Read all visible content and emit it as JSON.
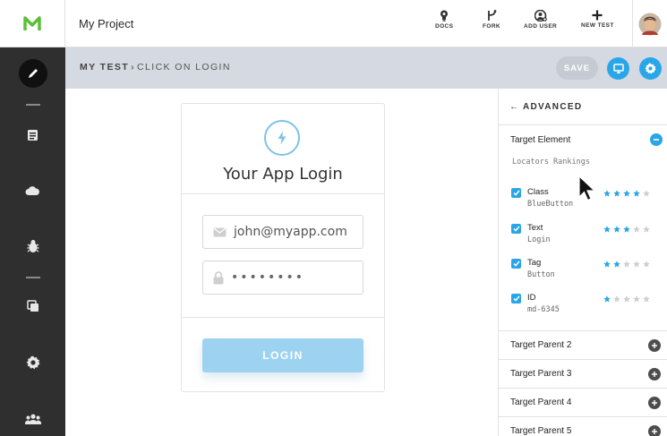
{
  "app": {
    "project_title": "My Project"
  },
  "sidebar": {
    "items": [
      {
        "icon": "pencil-icon",
        "active": true
      },
      {
        "icon": "list-icon"
      },
      {
        "icon": "cloud-icon"
      },
      {
        "icon": "bug-icon"
      },
      {
        "icon": "copy-icon"
      },
      {
        "icon": "gear-icon"
      },
      {
        "icon": "users-icon"
      }
    ]
  },
  "toolbar": {
    "docs_label": "DOCS",
    "fork_label": "FORK",
    "add_user_label": "ADD USER",
    "new_test_label": "NEW TEST"
  },
  "subheader": {
    "test_name": "MY TEST",
    "separator": "›",
    "step_name": "CLICK ON LOGIN",
    "save_label": "SAVE"
  },
  "login_card": {
    "title": "Your App Login",
    "email_value": "john@myapp.com",
    "password_value": "••••••••",
    "login_label": "LOGIN"
  },
  "panel": {
    "header": "← ADVANCED",
    "target_element_title": "Target Element",
    "locators_subtitle": "Locators Rankings",
    "locators": [
      {
        "name": "Class",
        "value": "BlueButton",
        "rating": 4,
        "max": 5
      },
      {
        "name": "Text",
        "value": "Login",
        "rating": 3,
        "max": 5
      },
      {
        "name": "Tag",
        "value": "Button",
        "rating": 2,
        "max": 5
      },
      {
        "name": "ID",
        "value": "md-6345",
        "rating": 1,
        "max": 5
      }
    ],
    "parents": [
      "Target Parent 2",
      "Target Parent 3",
      "Target Parent 4",
      "Target Parent 5"
    ]
  },
  "colors": {
    "accent": "#2aa6e8",
    "rail": "#2f2f2f",
    "subbar": "#d5d9e1",
    "login_button": "#9dd3f1",
    "star_on": "#2aa6e8",
    "star_off": "#cfcfcf"
  }
}
